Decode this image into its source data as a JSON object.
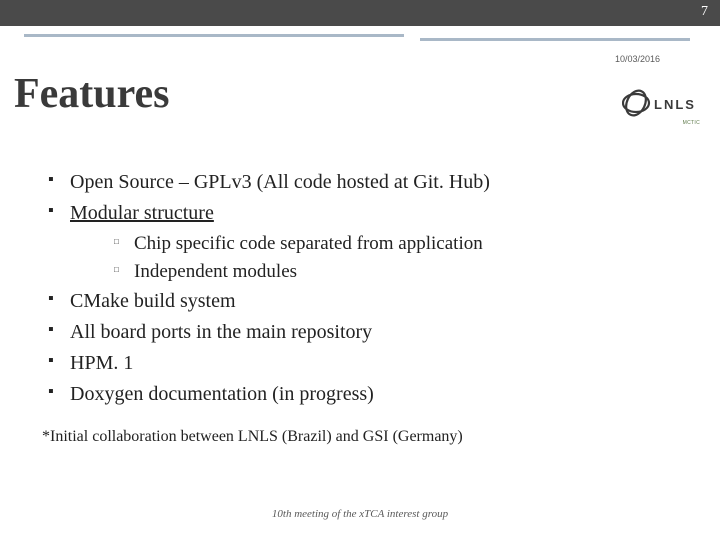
{
  "page_number": "7",
  "date": "10/03/2016",
  "title": "Features",
  "logo": {
    "text": "LNLS",
    "subtitle": "MCTIC"
  },
  "bullets": {
    "b1": "Open Source – GPLv3 (All code hosted at Git. Hub)",
    "b2": "Modular structure",
    "b2_sub1": "Chip specific code separated from application",
    "b2_sub2": "Independent modules",
    "b3": "CMake build system",
    "b4": "All board ports in the main repository",
    "b5": "HPM. 1",
    "b6": "Doxygen documentation (in progress)"
  },
  "footnote": "*Initial collaboration between LNLS (Brazil) and GSI (Germany)",
  "footer": "10th meeting of the xTCA interest group"
}
